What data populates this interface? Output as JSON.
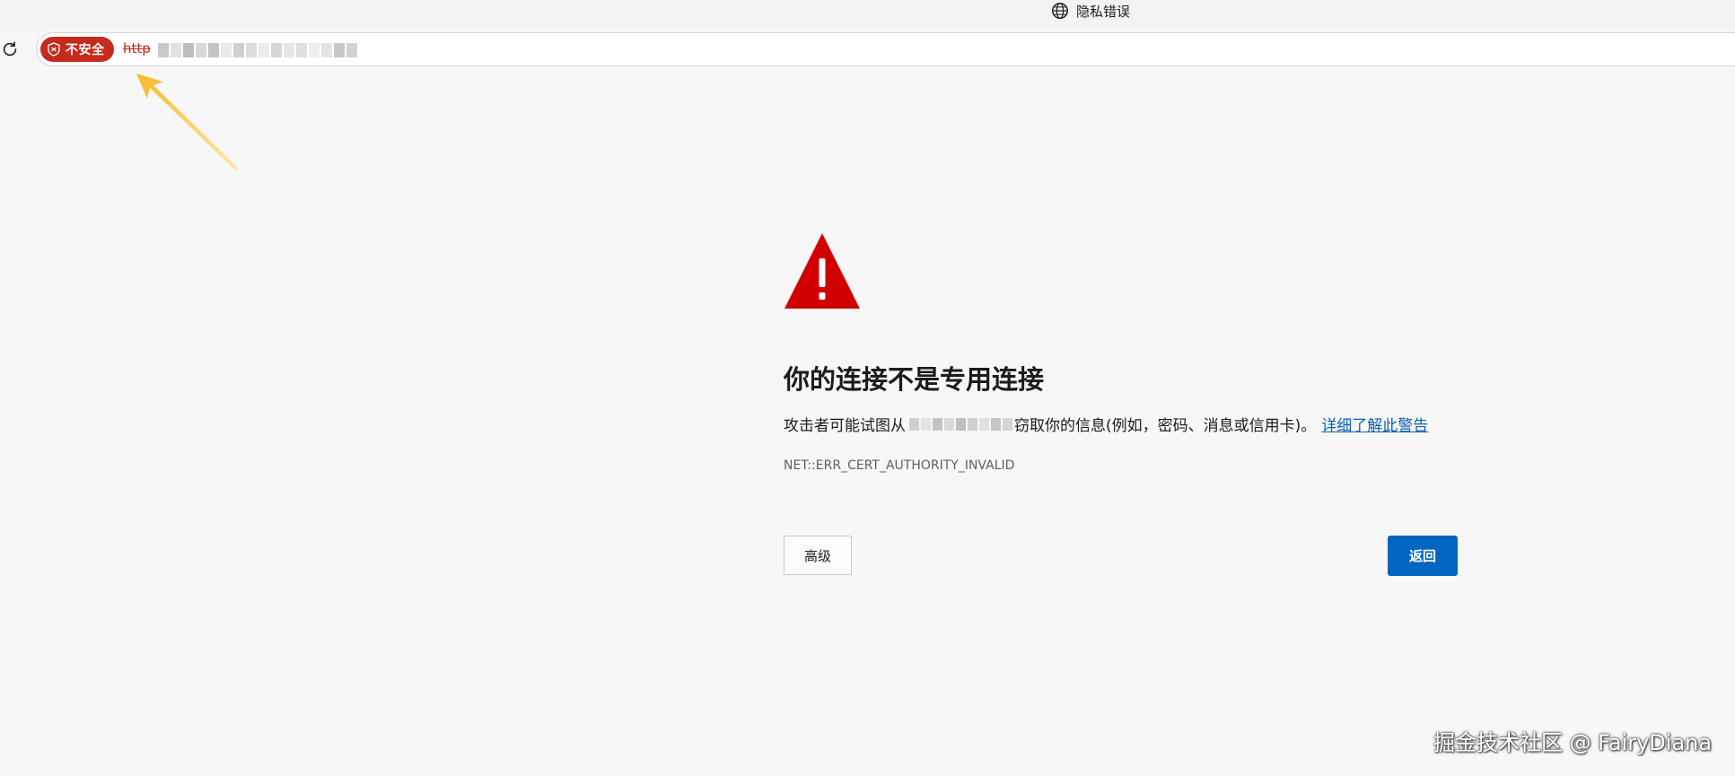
{
  "tab": {
    "title": "隐私错误",
    "icon": "globe-icon"
  },
  "addressbar": {
    "security_label": "不安全",
    "security_color": "#c42b1c",
    "url_prefix": "http",
    "refresh_icon": "refresh-icon",
    "shield_icon": "shield-icon"
  },
  "error": {
    "heading": "你的连接不是专用连接",
    "description_prefix": "攻击者可能试图从",
    "description_suffix": "窃取你的信息(例如，密码、消息或信用卡)。",
    "learn_more": "详细了解此警告",
    "code": "NET::ERR_CERT_AUTHORITY_INVALID",
    "warning_icon": "warning-triangle-icon",
    "warning_color": "#d10000"
  },
  "buttons": {
    "advanced": "高级",
    "back": "返回",
    "back_color": "#0067c0"
  },
  "watermark": "掘金技术社区 @ FairyDiana"
}
